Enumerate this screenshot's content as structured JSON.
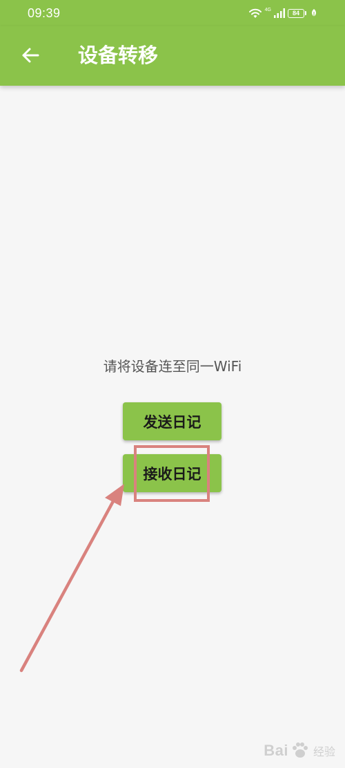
{
  "status_bar": {
    "time": "09:39",
    "network_label": "4G",
    "battery_level": "84",
    "icons": [
      "wifi-icon",
      "signal-icon",
      "battery-icon",
      "leaf-icon"
    ]
  },
  "app_bar": {
    "back_icon": "arrow-left-icon",
    "title": "设备转移"
  },
  "main": {
    "hint": "请将设备连至同一WiFi",
    "send_label": "发送日记",
    "receive_label": "接收日记"
  },
  "watermark": {
    "text": "Bai",
    "text_suffix": "经验",
    "icon": "paw-icon"
  },
  "colors": {
    "primary": "#8bc34a",
    "background": "#f6f6f6",
    "annotation": "#d9827e",
    "hint_text": "#555555"
  }
}
